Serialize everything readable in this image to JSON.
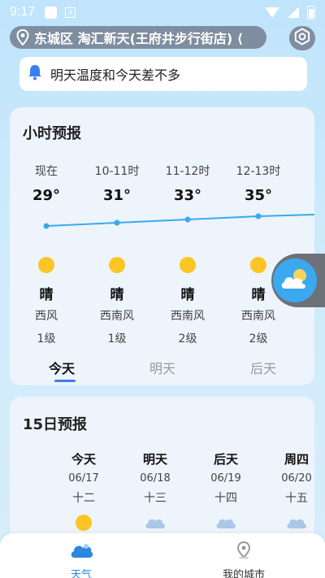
{
  "status_bar": {
    "time": "9:17",
    "a_icon_text": "A"
  },
  "location": {
    "text": "东城区 淘汇新天(王府井步行街店) ⟨"
  },
  "notice": {
    "text": "明天温度和今天差不多"
  },
  "hourly": {
    "title": "小时预报",
    "items": [
      {
        "label": "现在",
        "temp": "29°",
        "condition": "晴",
        "wind": "西风",
        "level": "1级"
      },
      {
        "label": "10-11时",
        "temp": "31°",
        "condition": "晴",
        "wind": "西南风",
        "level": "1级"
      },
      {
        "label": "11-12时",
        "temp": "33°",
        "condition": "晴",
        "wind": "西南风",
        "level": "2级"
      },
      {
        "label": "12-13时",
        "temp": "35°",
        "condition": "晴",
        "wind": "西南风",
        "level": "2级"
      }
    ],
    "tabs": [
      "今天",
      "明天",
      "后天"
    ]
  },
  "daily": {
    "title": "15日预报",
    "items": [
      {
        "name": "今天",
        "date": "06/17",
        "lunar": "十二",
        "icon": "sun-icon"
      },
      {
        "name": "明天",
        "date": "06/18",
        "lunar": "十三",
        "icon": "cloudy-icon"
      },
      {
        "name": "后天",
        "date": "06/19",
        "lunar": "十四",
        "icon": "cloudy-icon"
      },
      {
        "name": "周四",
        "date": "06/20",
        "lunar": "十五",
        "icon": "cloudy-icon"
      }
    ]
  },
  "nav": {
    "weather_label": "天气",
    "city_label": "我的城市"
  },
  "colors": {
    "accent": "#3a7ff0",
    "sun": "#fbc625",
    "temp_line": "#3aa9f0",
    "nav_active": "#2e86e0"
  }
}
